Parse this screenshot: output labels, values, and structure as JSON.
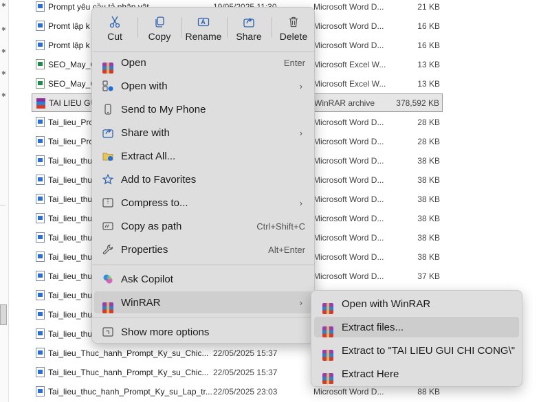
{
  "file_list": {
    "rows": [
      {
        "name": "Prompt yêu cầu tả nhận vật",
        "date": "19/05/2025 11:30",
        "type": "Microsoft Word D...",
        "size": "21 KB",
        "icon": "word"
      },
      {
        "name": "Promt lập k",
        "date": "",
        "type": "Microsoft Word D...",
        "size": "16 KB",
        "icon": "word"
      },
      {
        "name": "Promt lập k",
        "date": "",
        "type": "Microsoft Word D...",
        "size": "16 KB",
        "icon": "word"
      },
      {
        "name": "SEO_May_G",
        "date": "",
        "type": "Microsoft Excel W...",
        "size": "13 KB",
        "icon": "excel"
      },
      {
        "name": "SEO_May_G",
        "date": "",
        "type": "Microsoft Excel W...",
        "size": "13 KB",
        "icon": "excel"
      },
      {
        "name": "TAI LIEU GU",
        "date": "",
        "type": "WinRAR archive",
        "size": "378,592 KB",
        "icon": "rar",
        "selected": true
      },
      {
        "name": "Tai_lieu_Pro",
        "date": "",
        "type": "Microsoft Word D...",
        "size": "28 KB",
        "icon": "word"
      },
      {
        "name": "Tai_lieu_Pro",
        "date": "",
        "type": "Microsoft Word D...",
        "size": "28 KB",
        "icon": "word"
      },
      {
        "name": "Tai_lieu_thu",
        "date": "",
        "type": "Microsoft Word D...",
        "size": "38 KB",
        "icon": "word"
      },
      {
        "name": "Tai_lieu_thu",
        "date": "",
        "type": "Microsoft Word D...",
        "size": "38 KB",
        "icon": "word"
      },
      {
        "name": "Tai_lieu_thu",
        "date": "",
        "type": "Microsoft Word D...",
        "size": "38 KB",
        "icon": "word"
      },
      {
        "name": "Tai_lieu_thu",
        "date": "",
        "type": "Microsoft Word D...",
        "size": "38 KB",
        "icon": "word"
      },
      {
        "name": "Tai_lieu_thu",
        "date": "",
        "type": "Microsoft Word D...",
        "size": "38 KB",
        "icon": "word"
      },
      {
        "name": "Tai_lieu_thu",
        "date": "",
        "type": "Microsoft Word D...",
        "size": "38 KB",
        "icon": "word"
      },
      {
        "name": "Tai_lieu_thu",
        "date": "",
        "type": "Microsoft Word D...",
        "size": "37 KB",
        "icon": "word"
      },
      {
        "name": "Tai_lieu_thu",
        "date": "",
        "type": "",
        "size": "",
        "icon": "word"
      },
      {
        "name": "Tai_lieu_thu",
        "date": "",
        "type": "",
        "size": "",
        "icon": "word"
      },
      {
        "name": "Tai_lieu_thu",
        "date": "",
        "type": "",
        "size": "",
        "icon": "word"
      },
      {
        "name": "Tai_lieu_Thuc_hanh_Prompt_Ky_su_Chic...",
        "date": "22/05/2025 15:37",
        "type": "",
        "size": "",
        "icon": "word"
      },
      {
        "name": "Tai_lieu_Thuc_hanh_Prompt_Ky_su_Chic...",
        "date": "22/05/2025 15:37",
        "type": "",
        "size": "",
        "icon": "word"
      },
      {
        "name": "Tai_lieu_thuc_hanh_Prompt_Ky_su_Lap_tr...",
        "date": "22/05/2025 23:03",
        "type": "Microsoft Word D...",
        "size": "88 KB",
        "icon": "word"
      }
    ]
  },
  "context_menu": {
    "quick_actions": [
      {
        "label": "Cut",
        "icon": "scissors-icon"
      },
      {
        "label": "Copy",
        "icon": "copy-icon"
      },
      {
        "label": "Rename",
        "icon": "rename-icon"
      },
      {
        "label": "Share",
        "icon": "share-icon"
      },
      {
        "label": "Delete",
        "icon": "trash-icon"
      }
    ],
    "items": [
      {
        "label": "Open",
        "shortcut": "Enter",
        "icon": "winrar-icon"
      },
      {
        "label": "Open with",
        "submenu": true,
        "icon": "open-with-icon"
      },
      {
        "label": "Send to My Phone",
        "icon": "phone-icon"
      },
      {
        "label": "Share with",
        "submenu": true,
        "icon": "share-with-icon"
      },
      {
        "label": "Extract All...",
        "icon": "extract-all-icon"
      },
      {
        "label": "Add to Favorites",
        "icon": "star-icon"
      },
      {
        "label": "Compress to...",
        "submenu": true,
        "icon": "compress-icon"
      },
      {
        "label": "Copy as path",
        "shortcut": "Ctrl+Shift+C",
        "icon": "copy-path-icon"
      },
      {
        "label": "Properties",
        "shortcut": "Alt+Enter",
        "icon": "wrench-icon"
      },
      {
        "label": "Ask Copilot",
        "icon": "copilot-icon"
      },
      {
        "label": "WinRAR",
        "submenu": true,
        "icon": "winrar-icon"
      },
      {
        "label": "Show more options",
        "icon": "more-options-icon"
      }
    ]
  },
  "winrar_submenu": {
    "items": [
      {
        "label": "Open with WinRAR"
      },
      {
        "label": "Extract files..."
      },
      {
        "label": "Extract to \"TAI LIEU GUI CHI CONG\\\""
      },
      {
        "label": "Extract Here"
      }
    ]
  },
  "colors": {
    "menu_bg": "#dedede",
    "hover_bg": "#cfcfcf",
    "accent_blue": "#1e6fd9"
  }
}
